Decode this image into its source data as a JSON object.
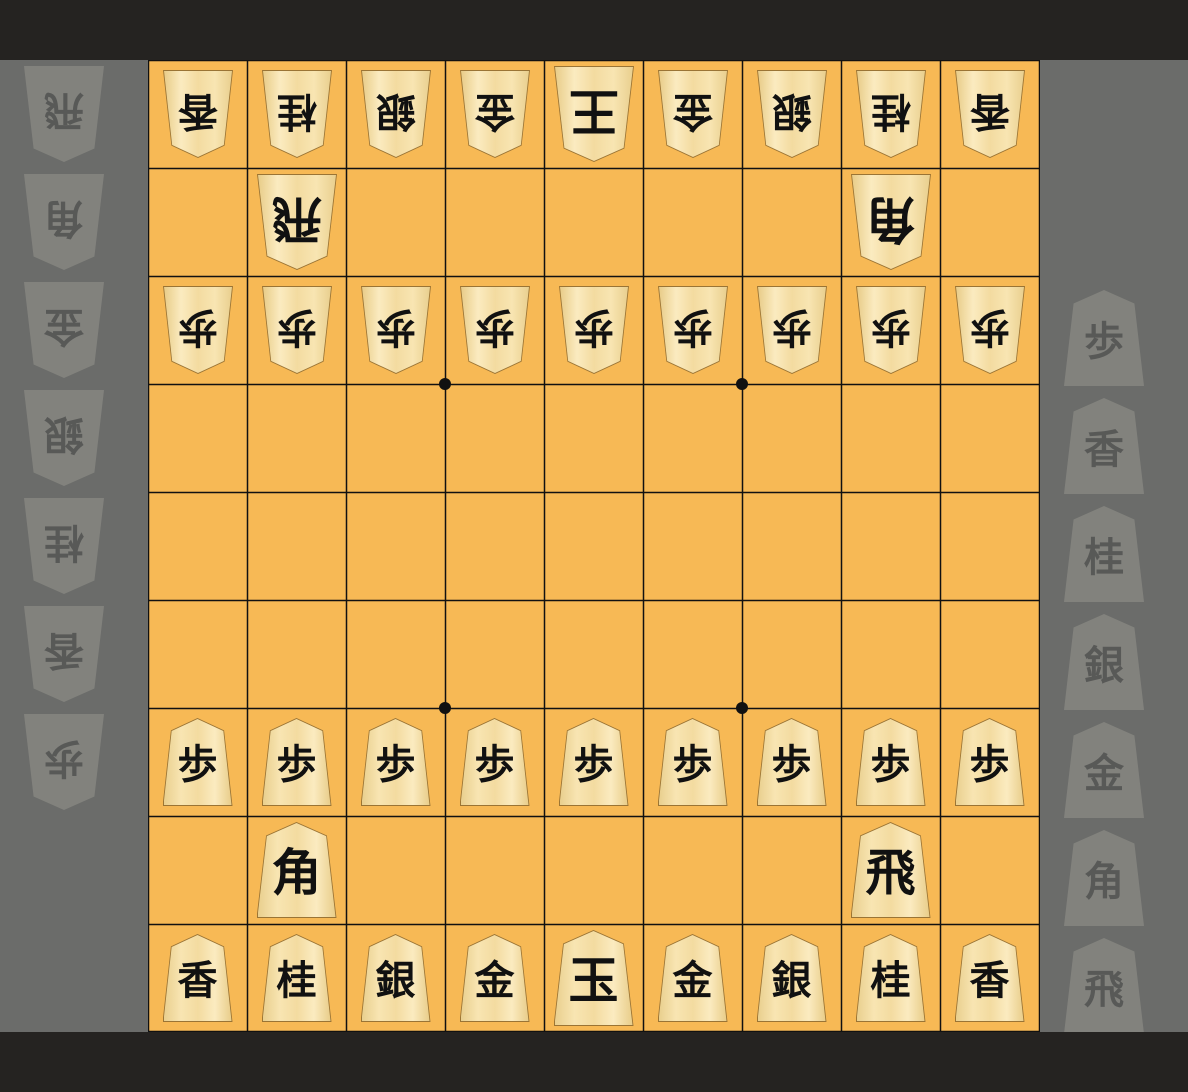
{
  "board": {
    "files": 9,
    "ranks": 9,
    "colors": {
      "board": "#f7b955",
      "line": "#111111",
      "background": "#252321",
      "hand_area": "#6b6c6a"
    },
    "rows": [
      [
        [
          "gote",
          "香"
        ],
        [
          "gote",
          "桂"
        ],
        [
          "gote",
          "銀"
        ],
        [
          "gote",
          "金"
        ],
        [
          "gote",
          "王"
        ],
        [
          "gote",
          "金"
        ],
        [
          "gote",
          "銀"
        ],
        [
          "gote",
          "桂"
        ],
        [
          "gote",
          "香"
        ]
      ],
      [
        null,
        [
          "gote",
          "飛"
        ],
        null,
        null,
        null,
        null,
        null,
        [
          "gote",
          "角"
        ],
        null
      ],
      [
        [
          "gote",
          "歩"
        ],
        [
          "gote",
          "歩"
        ],
        [
          "gote",
          "歩"
        ],
        [
          "gote",
          "歩"
        ],
        [
          "gote",
          "歩"
        ],
        [
          "gote",
          "歩"
        ],
        [
          "gote",
          "歩"
        ],
        [
          "gote",
          "歩"
        ],
        [
          "gote",
          "歩"
        ]
      ],
      [
        null,
        null,
        null,
        null,
        null,
        null,
        null,
        null,
        null
      ],
      [
        null,
        null,
        null,
        null,
        null,
        null,
        null,
        null,
        null
      ],
      [
        null,
        null,
        null,
        null,
        null,
        null,
        null,
        null,
        null
      ],
      [
        [
          "sente",
          "歩"
        ],
        [
          "sente",
          "歩"
        ],
        [
          "sente",
          "歩"
        ],
        [
          "sente",
          "歩"
        ],
        [
          "sente",
          "歩"
        ],
        [
          "sente",
          "歩"
        ],
        [
          "sente",
          "歩"
        ],
        [
          "sente",
          "歩"
        ],
        [
          "sente",
          "歩"
        ]
      ],
      [
        null,
        [
          "sente",
          "角"
        ],
        null,
        null,
        null,
        null,
        null,
        [
          "sente",
          "飛"
        ],
        null
      ],
      [
        [
          "sente",
          "香"
        ],
        [
          "sente",
          "桂"
        ],
        [
          "sente",
          "銀"
        ],
        [
          "sente",
          "金"
        ],
        [
          "sente",
          "玉"
        ],
        [
          "sente",
          "金"
        ],
        [
          "sente",
          "銀"
        ],
        [
          "sente",
          "桂"
        ],
        [
          "sente",
          "香"
        ]
      ]
    ]
  },
  "hands": {
    "gote": [
      "飛",
      "角",
      "金",
      "銀",
      "桂",
      "香",
      "歩"
    ],
    "sente": [
      "歩",
      "香",
      "桂",
      "銀",
      "金",
      "角",
      "飛"
    ]
  }
}
